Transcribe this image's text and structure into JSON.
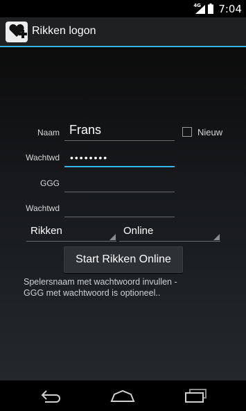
{
  "status": {
    "network": "4G",
    "time": "7:04"
  },
  "app": {
    "title": "Rikken logon"
  },
  "form": {
    "naam_label": "Naam",
    "naam_value": "Frans",
    "nieuw_label": "Nieuw",
    "wachtwd_label": "Wachtwd",
    "wachtwd_masked": "••••••••",
    "ggg_label": "GGG",
    "ggg_value": "",
    "ggg_wachtwd_label": "Wachtwd",
    "ggg_wachtwd_value": "",
    "game_select": "Rikken",
    "mode_select": "Online",
    "start_button": "Start Rikken Online",
    "hint_line1": "Spelersnaam met wachtwoord invullen -",
    "hint_line2": "GGG met wachtwoord is optioneel.."
  },
  "nav": {
    "back": "back-icon",
    "home": "home-icon",
    "recents": "recents-icon"
  },
  "colors": {
    "accent": "#33b5e5",
    "action_bar": "#1f2022"
  }
}
